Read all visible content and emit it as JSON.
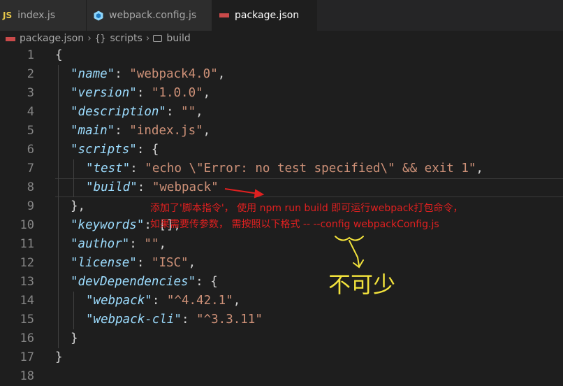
{
  "tabs": [
    {
      "icon": "JS",
      "label": "index.js",
      "active": false
    },
    {
      "icon": "webpack-cube-icon",
      "label": "webpack.config.js",
      "active": false
    },
    {
      "icon": "npm-icon",
      "label": "package.json",
      "active": true,
      "dirty": true
    }
  ],
  "breadcrumb": {
    "file": "package.json",
    "braces": "{}",
    "scripts": "scripts",
    "build": "build"
  },
  "editor": {
    "line_numbers": [
      "1",
      "2",
      "3",
      "4",
      "5",
      "6",
      "7",
      "8",
      "9",
      "10",
      "11",
      "12",
      "13",
      "14",
      "15",
      "16",
      "17",
      "18"
    ],
    "lines": [
      {
        "text": "{"
      },
      {
        "key": "\"name\"",
        "value": "\"webpack4.0\"",
        "tail": ","
      },
      {
        "key": "\"version\"",
        "value": "\"1.0.0\"",
        "tail": ","
      },
      {
        "key": "\"description\"",
        "value": "\"\"",
        "tail": ","
      },
      {
        "key": "\"main\"",
        "value": "\"index.js\"",
        "tail": ","
      },
      {
        "key": "\"scripts\"",
        "open": "{"
      },
      {
        "key": "\"test\"",
        "value": "\"echo \\\"Error: no test specified\\\" && exit 1\"",
        "tail": ","
      },
      {
        "key": "\"build\"",
        "value": "\"webpack\""
      },
      {
        "text": "},"
      },
      {
        "key": "\"keywords\"",
        "value": "[]",
        "tail": ","
      },
      {
        "key": "\"author\"",
        "value": "\"\"",
        "tail": ","
      },
      {
        "key": "\"license\"",
        "value": "\"ISC\"",
        "tail": ","
      },
      {
        "key": "\"devDependencies\"",
        "open": "{"
      },
      {
        "key": "\"webpack\"",
        "value": "\"^4.42.1\"",
        "tail": ","
      },
      {
        "key": "\"webpack-cli\"",
        "value": "\"^3.3.11\""
      },
      {
        "text": "}"
      },
      {
        "text": "}"
      },
      {
        "text": ""
      }
    ]
  },
  "annotations": {
    "line1": "添加了'脚本指令'， 使用 npm run build 即可运行webpack打包命令，",
    "line2": "如果需要传参数， 需按照以下格式 -- --config webpackConfig.js",
    "handwritten": "不可少"
  },
  "colors": {
    "background": "#1e1e1e",
    "key": "#9cdcfe",
    "string": "#ce9178",
    "annotation": "#e02020",
    "handwriting": "#f2e23c"
  }
}
